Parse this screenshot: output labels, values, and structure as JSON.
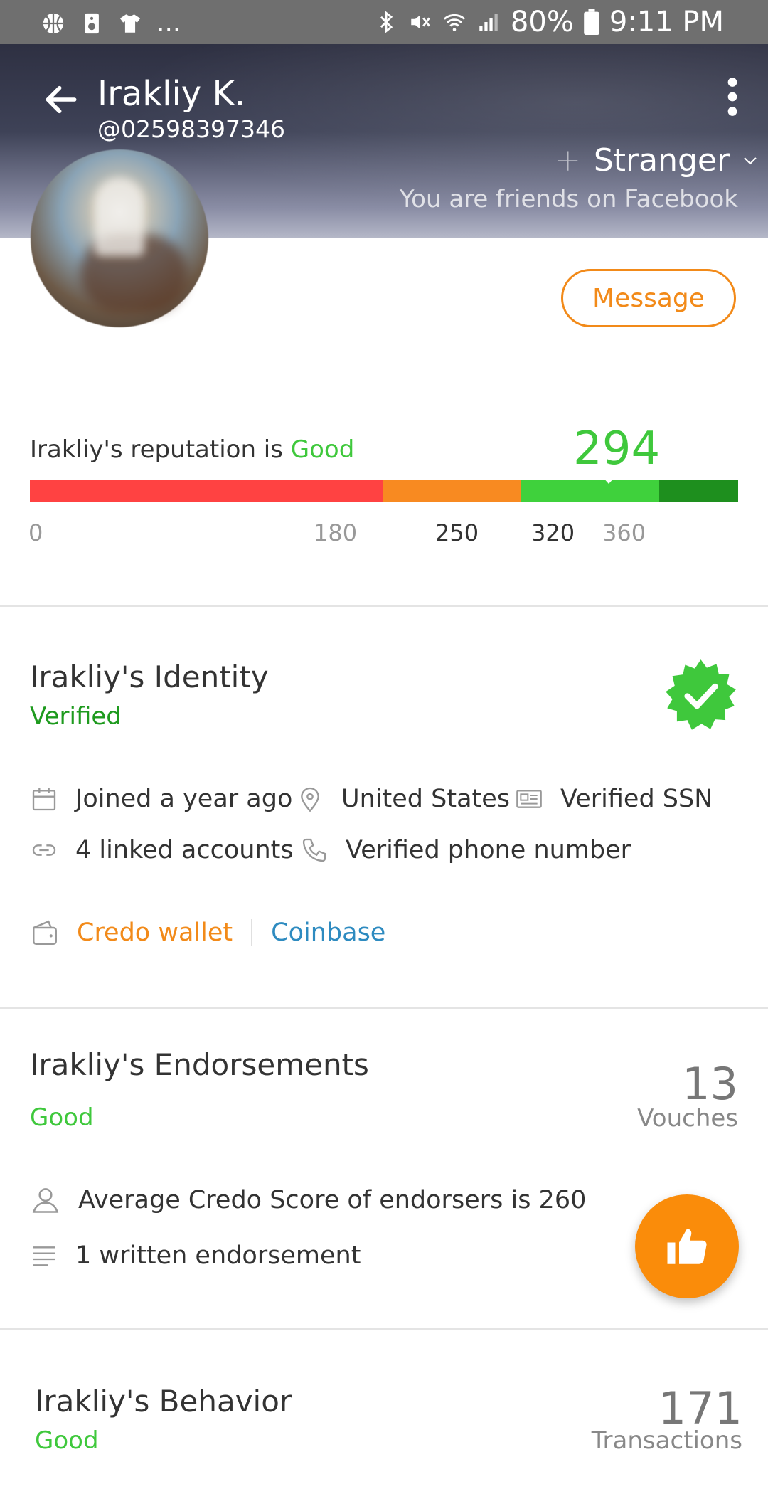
{
  "status_bar": {
    "battery": "80%",
    "time": "9:11 PM",
    "more": "..."
  },
  "profile": {
    "name": "Irakliy K.",
    "handle": "@02598397346",
    "relationship": "Stranger",
    "facebook_note": "You are friends on Facebook",
    "message_button": "Message"
  },
  "reputation": {
    "label_prefix": "Irakliy's reputation is ",
    "label_status": "Good",
    "score": "294",
    "ticks": [
      "0",
      "180",
      "250",
      "320",
      "360"
    ],
    "colors": {
      "bad": "#ff4242",
      "fair": "#f88a21",
      "good": "#3fd13c",
      "excellent": "#1e8f1e"
    }
  },
  "identity": {
    "title": "Irakliy's Identity",
    "status": "Verified",
    "joined": "Joined a year ago",
    "location": "United States",
    "ssn": "Verified SSN",
    "linked": "4 linked accounts",
    "phone": "Verified phone number",
    "wallet_credo": "Credo wallet",
    "wallet_coinbase": "Coinbase"
  },
  "endorsements": {
    "title": "Irakliy's Endorsements",
    "status": "Good",
    "count": "13",
    "count_label": "Vouches",
    "avg_score": "Average Credo Score of endorsers is 260",
    "written": "1 written endorsement"
  },
  "behavior": {
    "title": "Irakliy's Behavior",
    "status": "Good",
    "count": "171",
    "count_label": "Transactions"
  }
}
